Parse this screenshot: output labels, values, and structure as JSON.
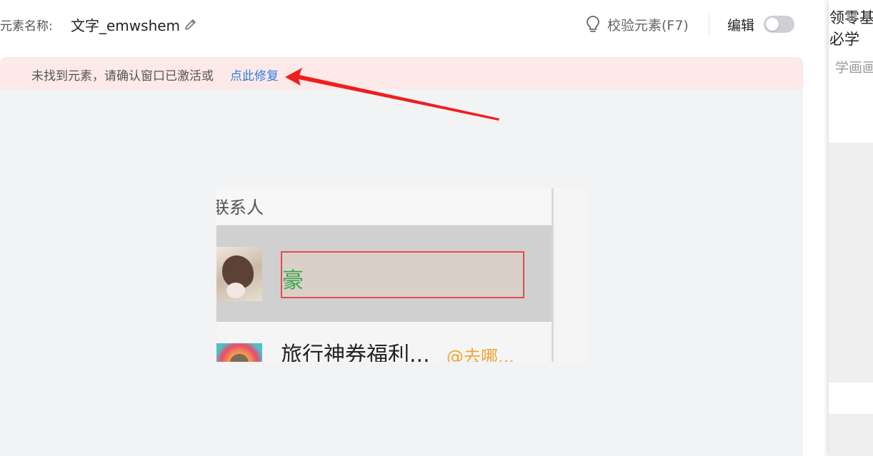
{
  "header": {
    "element_label": "元素名称:",
    "element_name": "文字_emwshem",
    "verify_label": "校验元素(F7)",
    "edit_label": "编辑",
    "edit_toggle_on": false
  },
  "alert": {
    "message": "未找到元素，请确认窗口已激活或",
    "fix_link": "点此修复",
    "icon_glyph": "i",
    "color": "#f04e4e"
  },
  "snapshot": {
    "header_text": "联系人",
    "highlighted_text": "豪",
    "row2_title": "旅行神券福利...",
    "row2_sub": "@去哪..."
  },
  "right_panel": {
    "title_line1": "领零基",
    "title_line2": "必学",
    "subtitle": "学画画"
  },
  "colors": {
    "link": "#2f7de1",
    "alert_bg": "#fde9e7",
    "highlight_border": "#e84a4a",
    "arrow": "#f01e1e"
  }
}
